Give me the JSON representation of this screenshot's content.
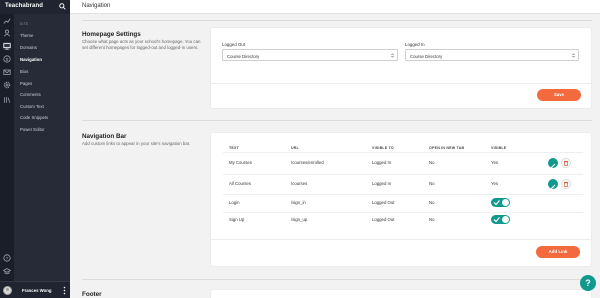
{
  "brand": {
    "name": "Teachabrand"
  },
  "header": {
    "title": "Navigation"
  },
  "sidebar": {
    "section_label": "SITE",
    "items": [
      {
        "label": "Theme",
        "active": false
      },
      {
        "label": "Domains",
        "active": false
      },
      {
        "label": "Navigation",
        "active": true
      },
      {
        "label": "Bios",
        "active": false
      },
      {
        "label": "Pages",
        "active": false
      },
      {
        "label": "Comments",
        "active": false
      },
      {
        "label": "Custom Text",
        "active": false
      },
      {
        "label": "Code Snippets",
        "active": false
      },
      {
        "label": "Power Editor",
        "active": false
      }
    ],
    "rail_icons": [
      "chart-icon",
      "users-icon",
      "monitor-icon",
      "dollar-icon",
      "mail-icon",
      "gear-icon",
      "library-icon",
      "help-circle-icon",
      "graduation-cap-icon"
    ]
  },
  "user": {
    "name": "Frances Wong"
  },
  "homepage_settings": {
    "title": "Homepage Settings",
    "description": "Choose what page acts as your school's homepage. You can set different homepages for logged-out and logged-in users.",
    "logged_out": {
      "label": "Logged Out",
      "value": "Course Directory"
    },
    "logged_in": {
      "label": "Logged In",
      "value": "Course Directory"
    },
    "save_label": "Save"
  },
  "navigation_bar": {
    "title": "Navigation Bar",
    "description": "Add custom links to appear in your site's navigation bar.",
    "columns": [
      "TEXT",
      "URL",
      "VISIBLE TO",
      "OPEN IN NEW TAB",
      "VISIBLE"
    ],
    "rows": [
      {
        "text": "My Courses",
        "url": "/courses/enrolled",
        "visible_to": "Logged In",
        "new_tab": "No",
        "visible": "Yes",
        "editable": true
      },
      {
        "text": "All Courses",
        "url": "/courses",
        "visible_to": "Logged In",
        "new_tab": "No",
        "visible": "Yes",
        "editable": true
      },
      {
        "text": "Login",
        "url": "/sign_in",
        "visible_to": "Logged Out",
        "new_tab": "No",
        "visible": "toggle-on",
        "editable": false
      },
      {
        "text": "Sign Up",
        "url": "/sign_up",
        "visible_to": "Logged Out",
        "new_tab": "No",
        "visible": "toggle-on",
        "editable": false
      }
    ],
    "add_link_label": "Add Link"
  },
  "footer_section": {
    "title": "Footer"
  },
  "help": {
    "label": "?"
  },
  "colors": {
    "accent": "#f26a3d",
    "teal": "#12998e",
    "sidebar": "#262b37"
  }
}
